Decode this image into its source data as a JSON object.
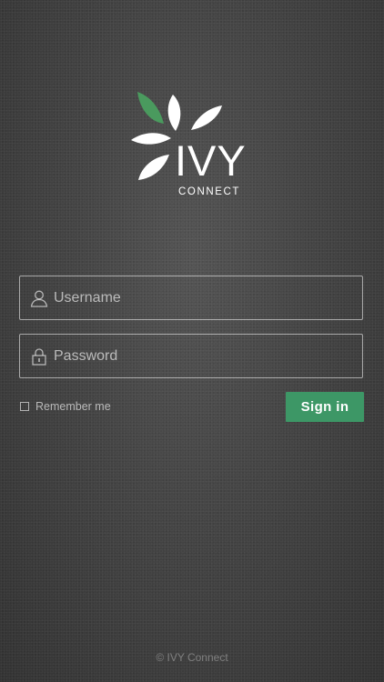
{
  "app": {
    "logo_wordmark": "IVY",
    "logo_tagline": "CONNECT"
  },
  "login": {
    "username": {
      "placeholder": "Username",
      "value": "",
      "icon": "user-icon"
    },
    "password": {
      "placeholder": "Password",
      "value": "",
      "icon": "lock-icon"
    },
    "remember_me_label": "Remember me",
    "remember_me_checked": false,
    "sign_in_label": "Sign in"
  },
  "footer": {
    "copyright": "© IVY Connect"
  },
  "colors": {
    "background": "#444444",
    "accent_green": "#3d9766",
    "leaf_green": "#4a9a5e",
    "text_white": "#ffffff"
  }
}
